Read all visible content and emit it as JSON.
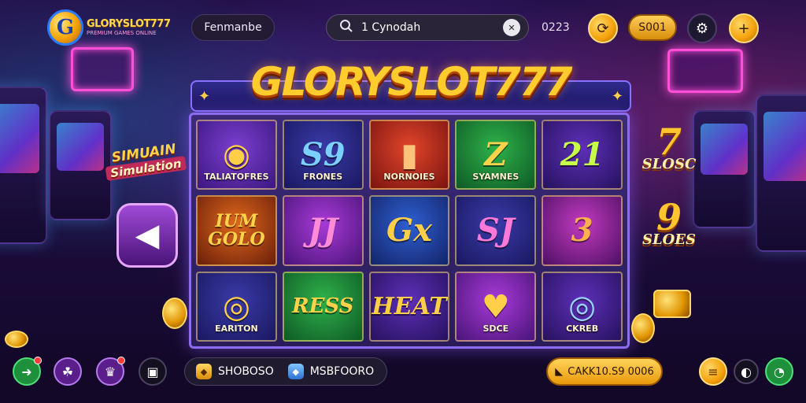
{
  "header": {
    "logo_title": "GLORYSLOT777",
    "logo_sub": "PREMIUM GAMES ONLINE",
    "logo_mark": "G",
    "menu_label": "Fenmanbe",
    "search_value": "1 Cynodah",
    "counter": "0223",
    "balance": "S001"
  },
  "banner": {
    "title": "GLORYSLOT777"
  },
  "side": {
    "badge_line1": "SIMUAIN",
    "badge_line2": "Simulation",
    "back_symbol": "◀",
    "right_top": {
      "big": "7",
      "small": "SLOSC"
    },
    "right_mid": {
      "big": "9",
      "small": "SLOES"
    }
  },
  "tiles": [
    {
      "sym": "◉",
      "label": "TALIATOFRES",
      "color": "#ffcf4a"
    },
    {
      "sym": "S9",
      "label": "FRONES",
      "color": "#7ad0ff"
    },
    {
      "sym": "▮",
      "label": "NORNOIES",
      "color": "#ffc27a"
    },
    {
      "sym": "Z",
      "label": "SYAMNES",
      "color": "#ffd24a"
    },
    {
      "sym": "21",
      "label": "",
      "color": "#c6ff4a"
    },
    {
      "sym": "IUM GOLO",
      "label": "",
      "color": "#ffd24a"
    },
    {
      "sym": "JJ",
      "label": "",
      "color": "#ff8ad8"
    },
    {
      "sym": "Gx",
      "label": "",
      "color": "#ffcf4a"
    },
    {
      "sym": "SJ",
      "label": "",
      "color": "#ff7ad8"
    },
    {
      "sym": "3",
      "label": "",
      "color": "#ffb04a"
    },
    {
      "sym": "◎",
      "label": "EARITON",
      "color": "#ffcf4a"
    },
    {
      "sym": "RESS",
      "label": "",
      "color": "#ffd24a"
    },
    {
      "sym": "HEAT",
      "label": "",
      "color": "#ffcf4a"
    },
    {
      "sym": "♥",
      "label": "SDCE",
      "color": "#ffcf4a"
    },
    {
      "sym": "◎",
      "label": "CKREB",
      "color": "#9ad0ff"
    }
  ],
  "bottom": {
    "item1": "SHOBOSO",
    "item2": "MSBFOORO",
    "claim": "CAKK10.S9 0006"
  },
  "colors": {
    "accent_gold": "#ffcc2e",
    "frame_purple": "#8c6cf0",
    "bg_dark": "#1a0b33"
  },
  "icons": {
    "search": "search-icon",
    "settings": "gear-icon",
    "add": "plus-icon",
    "refresh": "refresh-icon"
  }
}
